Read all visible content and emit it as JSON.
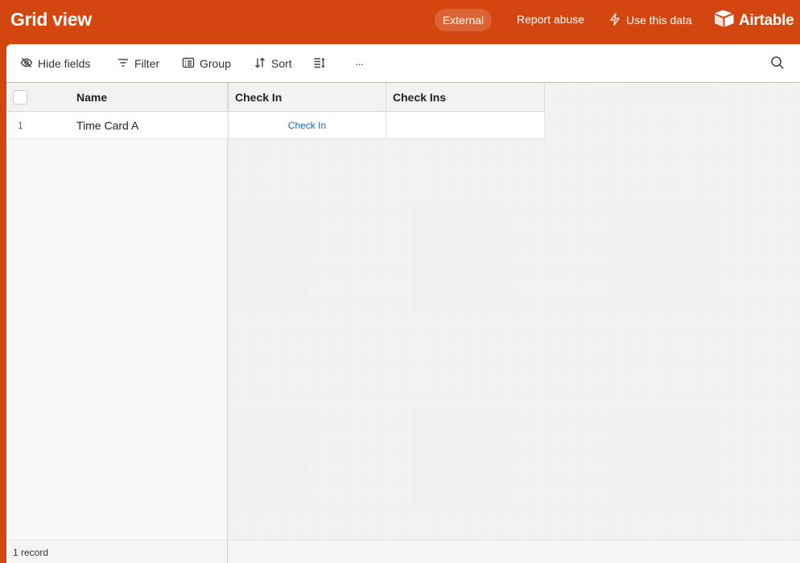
{
  "header": {
    "title": "Grid view",
    "badge": "External",
    "report_label": "Report abuse",
    "use_data_label": "Use this data",
    "brand": "Airtable"
  },
  "toolbar": {
    "hide_fields": "Hide fields",
    "filter": "Filter",
    "group": "Group",
    "sort": "Sort",
    "more": "···",
    "icons": [
      "eye-off-icon",
      "filter-icon",
      "group-icon",
      "sort-icon",
      "row-height-icon",
      "more-icon",
      "search-icon"
    ]
  },
  "grid": {
    "columns": [
      "Name",
      "Check In",
      "Check Ins"
    ],
    "rows": [
      {
        "number": "1",
        "name": "Time Card A",
        "check_in": "Check In",
        "check_ins": ""
      }
    ]
  },
  "footer": {
    "count": "1 record"
  },
  "colors": {
    "header_bg": "#d4460f",
    "link": "#1f62b5"
  }
}
